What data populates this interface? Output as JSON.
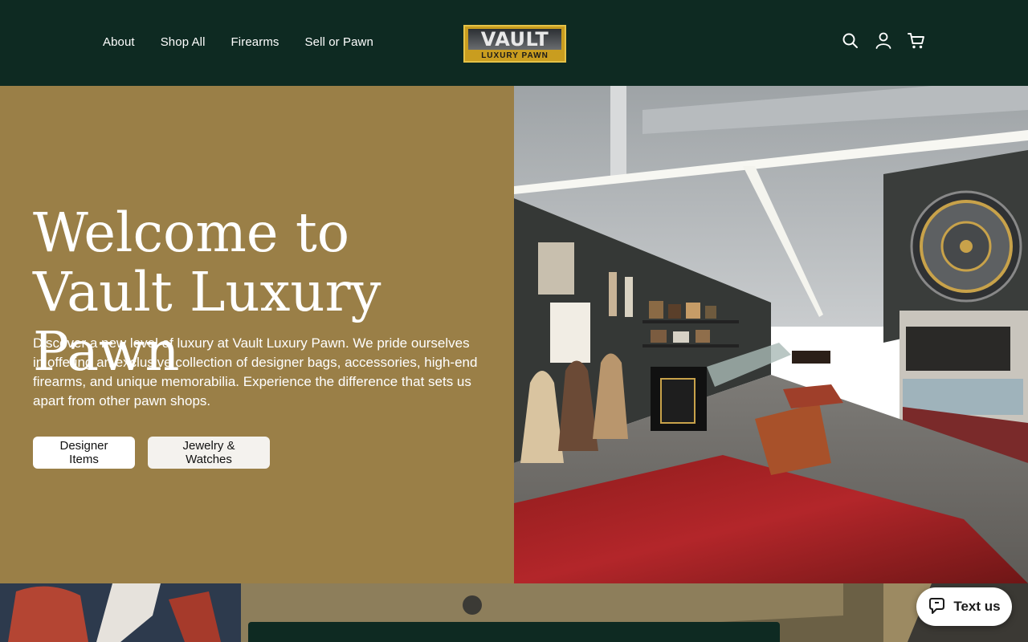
{
  "header": {
    "nav": [
      {
        "label": "About"
      },
      {
        "label": "Shop All"
      },
      {
        "label": "Firearms"
      },
      {
        "label": "Sell or Pawn"
      }
    ],
    "logo": {
      "line1": "VAULT",
      "line2": "LUXURY PAWN"
    },
    "icons": [
      "search-icon",
      "account-icon",
      "cart-icon"
    ]
  },
  "hero": {
    "title": "Welcome to Vault Luxury Pawn",
    "description": "Discover a new level of luxury at Vault Luxury Pawn. We pride ourselves in offering an exclusive collection of designer bags, accessories, high-end firearms, and unique memorabilia. Experience the difference that sets us apart from other pawn shops.",
    "buttons": [
      {
        "label": "Designer Items"
      },
      {
        "label": "Jewelry & Watches"
      }
    ]
  },
  "chat_widget": {
    "label": "Text us"
  },
  "colors": {
    "header_bg": "#0e2a22",
    "hero_bg": "#9a7f47",
    "logo_gold": "#c99d1f",
    "text_light": "#ffffff"
  }
}
